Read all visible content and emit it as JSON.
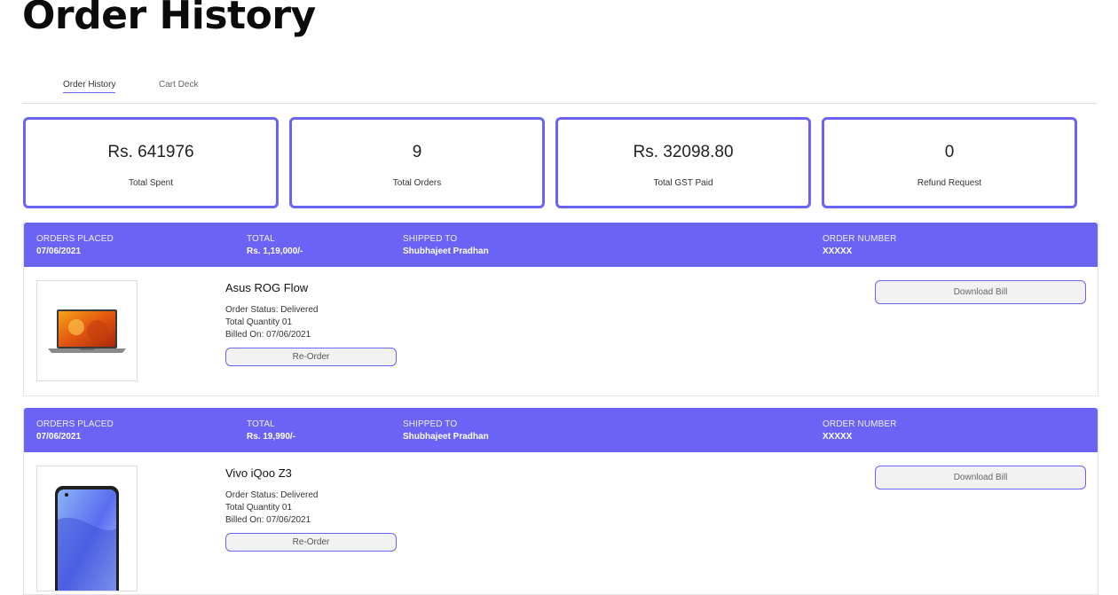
{
  "page": {
    "title": "Order History"
  },
  "tabs": [
    {
      "label": "Order History",
      "active": true
    },
    {
      "label": "Cart Deck",
      "active": false
    }
  ],
  "stats": [
    {
      "value": "Rs. 641976",
      "label": "Total Spent"
    },
    {
      "value": "9",
      "label": "Total Orders"
    },
    {
      "value": "Rs. 32098.80",
      "label": "Total GST Paid"
    },
    {
      "value": "0",
      "label": "Refund Request"
    }
  ],
  "order_columns": {
    "placed": "ORDERS PLACED",
    "total": "TOTAL",
    "shipped": "SHIPPED TO",
    "number": "ORDER NUMBER"
  },
  "orders": [
    {
      "placed": "07/06/2021",
      "total": "Rs. 1,19,000/-",
      "shipped_to": "Shubhajeet Pradhan",
      "order_number": "XXXXX",
      "product": "Asus ROG Flow",
      "status": "Order Status: Delivered",
      "quantity": "Total Quantity 01",
      "billed": "Billed On: 07/06/2021",
      "reorder_label": "Re-Order",
      "download_label": "Download Bill",
      "image_icon": "laptop-icon"
    },
    {
      "placed": "07/06/2021",
      "total": "Rs. 19,990/-",
      "shipped_to": "Shubhajeet Pradhan",
      "order_number": "XXXXX",
      "product": "Vivo iQoo Z3",
      "status": "Order Status: Delivered",
      "quantity": "Total Quantity 01",
      "billed": "Billed On: 07/06/2021",
      "reorder_label": "Re-Order",
      "download_label": "Download Bill",
      "image_icon": "smartphone-icon"
    }
  ],
  "colors": {
    "accent": "#6a63f6",
    "border": "#dcdcdc"
  }
}
